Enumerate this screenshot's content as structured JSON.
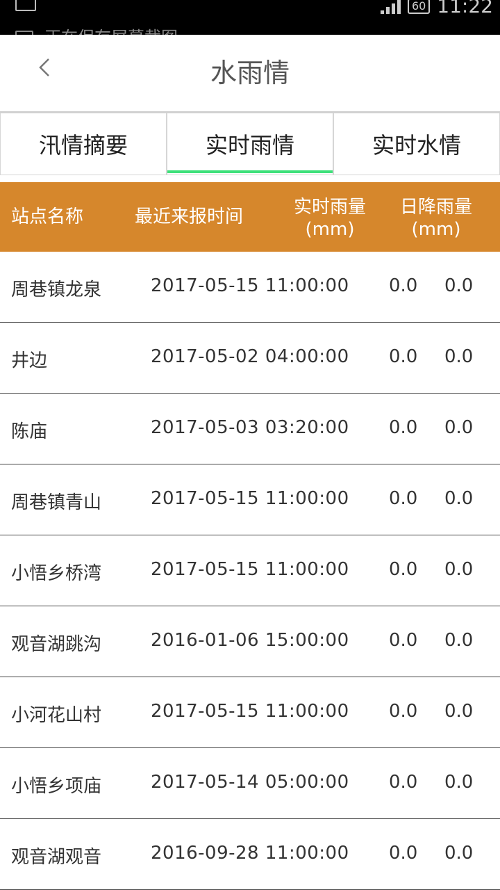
{
  "status_bar": {
    "notification": "正在保存屏幕截图",
    "battery": "60",
    "time": "11:22"
  },
  "header": {
    "title": "水雨情"
  },
  "tabs": [
    {
      "label": "汛情摘要",
      "active": false
    },
    {
      "label": "实时雨情",
      "active": true
    },
    {
      "label": "实时水情",
      "active": false
    }
  ],
  "table": {
    "columns": {
      "name": "站点名称",
      "time": "最近来报时间",
      "rain": "实时雨量",
      "rain_unit": "(mm)",
      "day": "日降雨量",
      "day_unit": "(mm)"
    },
    "rows": [
      {
        "name": "周巷镇龙泉",
        "time": "2017-05-15 11:00:00",
        "rain": "0.0",
        "day": "0.0"
      },
      {
        "name": "井边",
        "time": "2017-05-02 04:00:00",
        "rain": "0.0",
        "day": "0.0"
      },
      {
        "name": "陈庙",
        "time": "2017-05-03 03:20:00",
        "rain": "0.0",
        "day": "0.0"
      },
      {
        "name": "周巷镇青山",
        "time": "2017-05-15 11:00:00",
        "rain": "0.0",
        "day": "0.0"
      },
      {
        "name": "小悟乡桥湾",
        "time": "2017-05-15 11:00:00",
        "rain": "0.0",
        "day": "0.0"
      },
      {
        "name": "观音湖跳沟",
        "time": "2016-01-06 15:00:00",
        "rain": "0.0",
        "day": "0.0"
      },
      {
        "name": "小河花山村",
        "time": "2017-05-15 11:00:00",
        "rain": "0.0",
        "day": "0.0"
      },
      {
        "name": "小悟乡项庙",
        "time": "2017-05-14 05:00:00",
        "rain": "0.0",
        "day": "0.0"
      },
      {
        "name": "观音湖观音",
        "time": "2016-09-28 11:00:00",
        "rain": "0.0",
        "day": "0.0"
      }
    ]
  },
  "colors": {
    "table_header_bg": "#d6872c",
    "tab_active_underline": "#3ee07a"
  },
  "icons": {
    "back": "chevron-left-icon",
    "wifi": "wifi-icon",
    "signal": "signal-icon",
    "battery": "battery-icon"
  }
}
